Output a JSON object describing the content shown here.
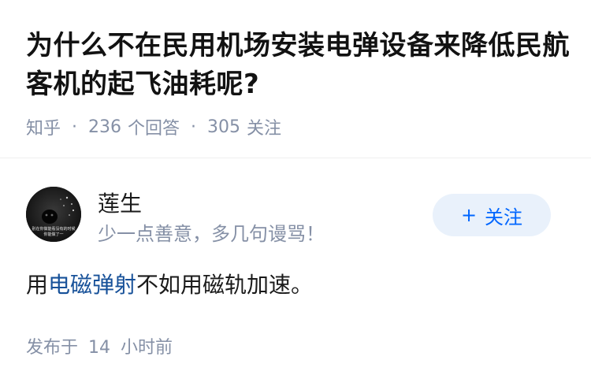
{
  "question": {
    "title": "为什么不在民用机场安装电弹设备来降低民航客机的起飞油耗呢?",
    "source": "知乎",
    "answers_count": "236",
    "answers_label": "个回答",
    "followers_count": "305",
    "followers_label": "关注"
  },
  "author": {
    "name": "莲生",
    "bio": "少一点善意，多几句谩骂！",
    "avatar_caption": "别在你做能看没有的时候\n你能做了一",
    "follow_label": "关注",
    "follow_icon": "plus-icon"
  },
  "answer": {
    "text_before": "用",
    "link_text": "电磁弹射",
    "text_after": "不如用磁轨加速。"
  },
  "meta": {
    "posted_prefix": "发布于",
    "posted_number": "14",
    "posted_suffix": "小时前"
  },
  "colors": {
    "link": "#175199",
    "follow_text": "#0066ff",
    "follow_bg": "#e9f1fb",
    "meta_gray": "#8590a6"
  }
}
